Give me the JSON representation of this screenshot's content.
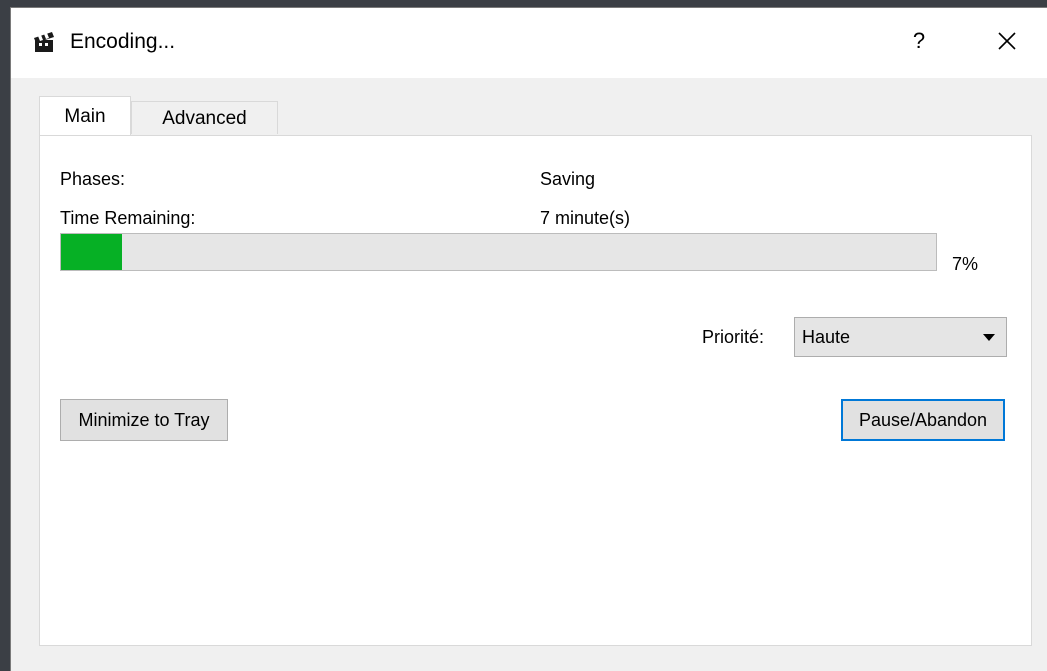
{
  "window": {
    "title": "Encoding...",
    "help_label": "?",
    "icon": "clapperboard-icon"
  },
  "tabs": [
    {
      "label": "Main",
      "active": true
    },
    {
      "label": "Advanced",
      "active": false
    }
  ],
  "main": {
    "phases_label": "Phases:",
    "phases_value": "Saving",
    "time_remaining_label": "Time Remaining:",
    "time_remaining_value": "7 minute(s)",
    "progress_percent": 7,
    "progress_text": "7%",
    "progress_color": "#06b025",
    "priority_label": "Priorité:",
    "priority_value": "Haute",
    "minimize_button": "Minimize to Tray",
    "pause_button": "Pause/Abandon",
    "focus_color": "#0078d7"
  }
}
